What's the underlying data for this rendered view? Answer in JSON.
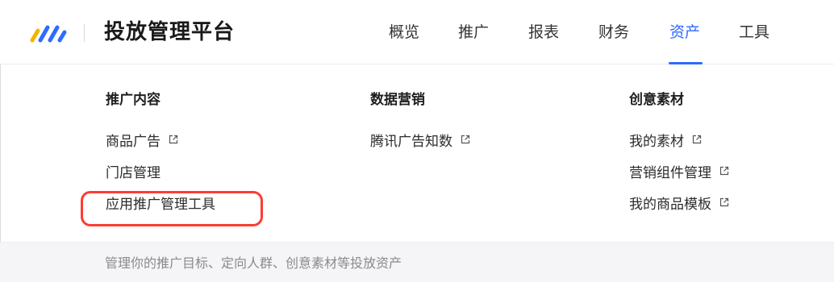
{
  "header": {
    "app_title": "投放管理平台",
    "logo_icon": "brand-stripes-icon",
    "nav": [
      {
        "label": "概览"
      },
      {
        "label": "推广"
      },
      {
        "label": "报表"
      },
      {
        "label": "财务"
      },
      {
        "label": "资产",
        "active": true
      },
      {
        "label": "工具"
      }
    ],
    "accent_color": "#2f6bff"
  },
  "dropdown": {
    "columns": [
      {
        "title": "推广内容",
        "items": [
          {
            "label": "商品广告",
            "external": true
          },
          {
            "label": "门店管理",
            "external": false
          },
          {
            "label": "应用推广管理工具",
            "external": false,
            "highlighted": true
          }
        ]
      },
      {
        "title": "数据营销",
        "items": [
          {
            "label": "腾讯广告知数",
            "external": true
          }
        ]
      },
      {
        "title": "创意素材",
        "items": [
          {
            "label": "我的素材",
            "external": true
          },
          {
            "label": "营销组件管理",
            "external": true
          },
          {
            "label": "我的商品模板",
            "external": true
          }
        ]
      }
    ],
    "external_icon": "external-link-icon",
    "highlight_color": "#ff3b30"
  },
  "footer": {
    "description": "管理你的推广目标、定向人群、创意素材等投放资产"
  }
}
